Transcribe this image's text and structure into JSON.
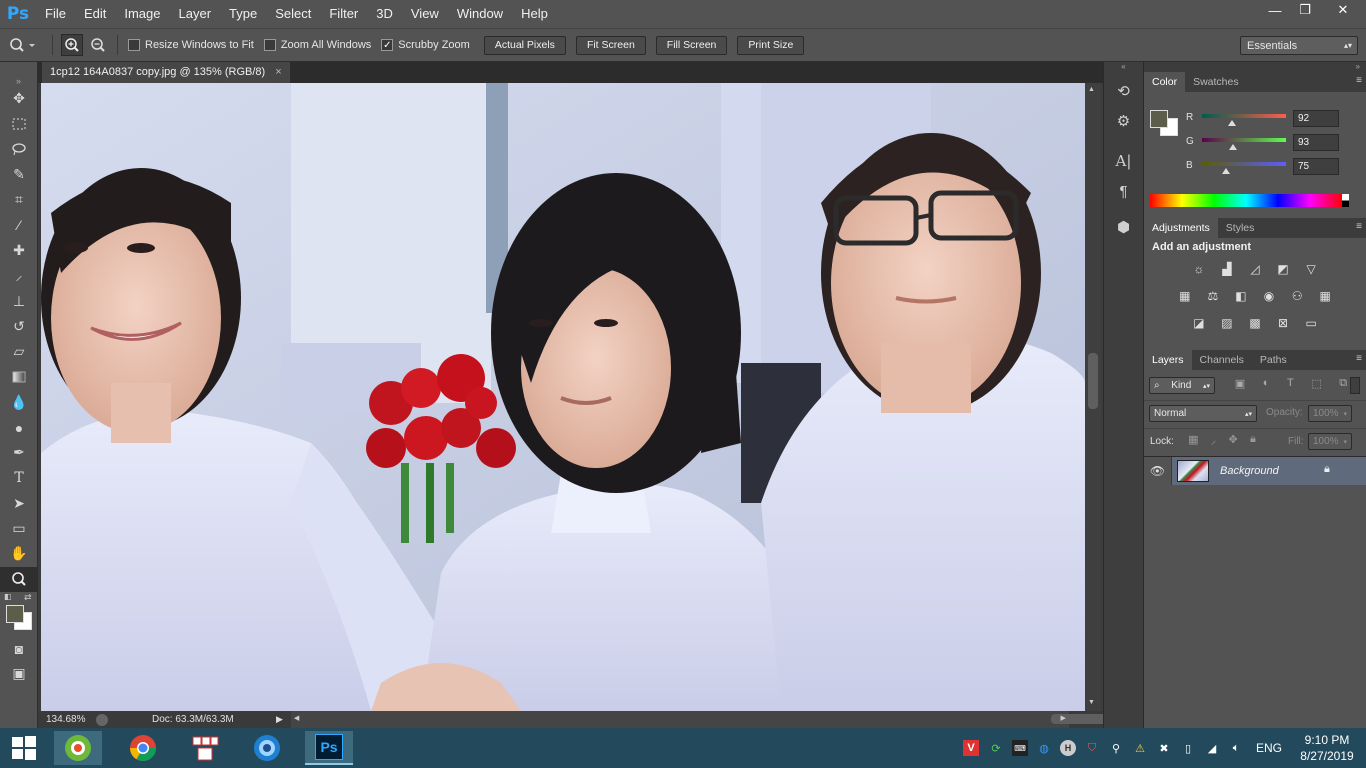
{
  "app": {
    "logo": "Ps",
    "menus": [
      "File",
      "Edit",
      "Image",
      "Layer",
      "Type",
      "Select",
      "Filter",
      "3D",
      "View",
      "Window",
      "Help"
    ],
    "window_controls": {
      "minimize": "—",
      "restore": "❐",
      "close": "✕"
    }
  },
  "options_bar": {
    "resize_windows": "Resize Windows to Fit",
    "resize_checked": false,
    "zoom_all": "Zoom All Windows",
    "zoom_all_checked": false,
    "scrubby": "Scrubby Zoom",
    "scrubby_checked": true,
    "buttons": [
      "Actual Pixels",
      "Fit Screen",
      "Fill Screen",
      "Print Size"
    ],
    "workspace": "Essentials"
  },
  "document": {
    "tab_title": "1cp12 164A0837 copy.jpg @ 135% (RGB/8)",
    "close": "×",
    "zoom_level": "134.68%",
    "doc_size": "Doc: 63.3M/63.3M"
  },
  "color_panel": {
    "tabs": [
      "Color",
      "Swatches"
    ],
    "channels": [
      {
        "label": "R",
        "value": "92",
        "level": 0.36
      },
      {
        "label": "G",
        "value": "93",
        "level": 0.365
      },
      {
        "label": "B",
        "value": "75",
        "level": 0.29
      }
    ],
    "foreground": "#5c5d4b",
    "background": "#ffffff"
  },
  "adjustments_panel": {
    "tabs": [
      "Adjustments",
      "Styles"
    ],
    "heading": "Add an adjustment",
    "row1": [
      "brightness-contrast-icon",
      "levels-icon",
      "curves-icon",
      "exposure-icon",
      "vibrance-icon"
    ],
    "row2": [
      "hue-saturation-icon",
      "color-balance-icon",
      "black-white-icon",
      "photo-filter-icon",
      "channel-mixer-icon",
      "color-lookup-icon"
    ],
    "row3": [
      "invert-icon",
      "posterize-icon",
      "threshold-icon",
      "selective-color-icon",
      "gradient-map-icon"
    ]
  },
  "layers_panel": {
    "tabs": [
      "Layers",
      "Channels",
      "Paths"
    ],
    "kind": "Kind",
    "blend_mode": "Normal",
    "opacity_label": "Opacity:",
    "opacity": "100%",
    "lock_label": "Lock:",
    "fill_label": "Fill:",
    "fill": "100%",
    "layers": [
      {
        "name": "Background",
        "visible": true,
        "locked": true
      }
    ]
  },
  "taskbar": {
    "apps": [
      "windows-start-icon",
      "coccoc-browser-icon",
      "chrome-icon",
      "unikey-icon",
      "camera-app-icon",
      "photoshop-icon"
    ],
    "language": "ENG",
    "time": "9:10 PM",
    "date": "8/27/2019"
  }
}
